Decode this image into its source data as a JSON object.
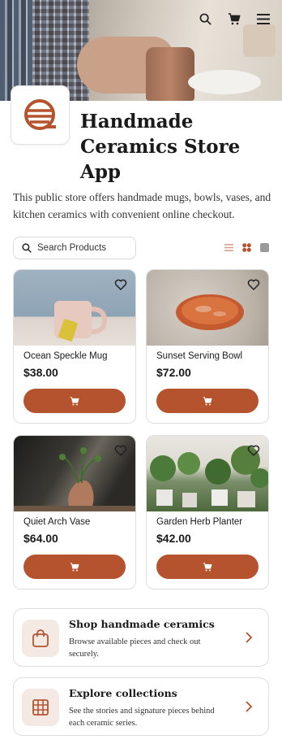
{
  "header": {
    "icons": [
      "search-icon",
      "cart-icon",
      "menu-icon"
    ]
  },
  "app": {
    "title_line1": "Handmade",
    "title_line2": "Ceramics Store App",
    "description": "This public store offers handmade mugs, bowls, vases, and kitchen ceramics with convenient online checkout."
  },
  "search": {
    "placeholder": "Search Products"
  },
  "view_toggle": [
    "list-view-icon",
    "grid-view-icon",
    "single-view-icon"
  ],
  "products": [
    {
      "name": "Ocean Speckle Mug",
      "price": "$38.00"
    },
    {
      "name": "Sunset Serving Bowl",
      "price": "$72.00"
    },
    {
      "name": "Quiet Arch Vase",
      "price": "$64.00"
    },
    {
      "name": "Garden Herb Planter",
      "price": "$42.00"
    }
  ],
  "features": [
    {
      "title": "Shop handmade ceramics",
      "subtitle": "Browse available pieces and check out securely."
    },
    {
      "title": "Explore collections",
      "subtitle": "See the stories and signature pieces behind each ceramic series."
    }
  ],
  "colors": {
    "accent": "#b5532f",
    "accent_light": "#f5e9e4",
    "border": "#dedede"
  }
}
